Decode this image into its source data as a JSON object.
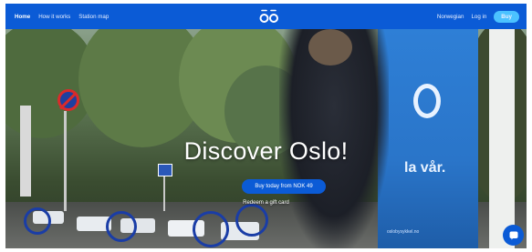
{
  "nav": {
    "items": [
      {
        "label": "Home",
        "active": true
      },
      {
        "label": "How it works",
        "active": false
      },
      {
        "label": "Station map",
        "active": false
      }
    ],
    "language": "Norwegian",
    "login": "Log in",
    "buy": "Buy"
  },
  "hero": {
    "title": "Discover Oslo!",
    "cta": "Buy today from NOK 49",
    "gift_link": "Redeem a gift card",
    "ad_text": "la vår.",
    "ad_url": "oslobysykkel.no"
  },
  "icons": {
    "logo": "oslo-bysykkel-logo",
    "chat": "chat-icon"
  },
  "colors": {
    "brand_blue": "#0b5bd6",
    "buy_button": "#4bc2ff"
  }
}
